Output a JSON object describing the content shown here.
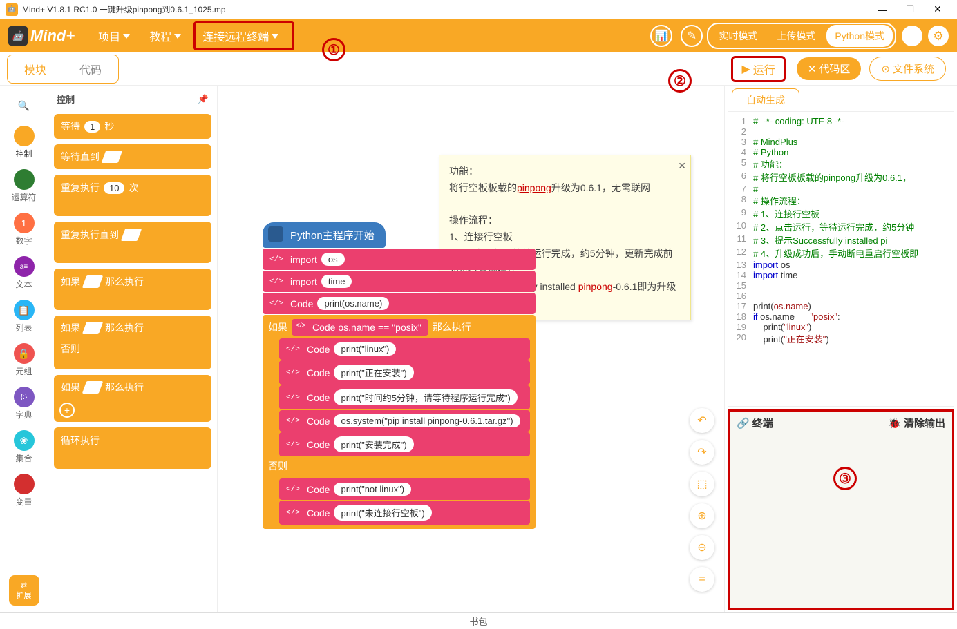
{
  "window": {
    "title": "Mind+ V1.8.1 RC1.0   一键升级pinpong到0.6.1_1025.mp"
  },
  "topmenu": {
    "logo": "Mind+",
    "project": "项目",
    "tutorial": "教程",
    "connect": "连接远程终端",
    "mode_realtime": "实时模式",
    "mode_upload": "上传模式",
    "mode_python": "Python模式"
  },
  "secbar": {
    "tab_blocks": "模块",
    "tab_code": "代码",
    "run": "运行",
    "code_area": "代码区",
    "file_system": "文件系统"
  },
  "annotations": {
    "a1": "①",
    "a2": "②",
    "a3": "③"
  },
  "categories": {
    "search": "",
    "control": "控制",
    "operators": "运算符",
    "numbers": "数字",
    "text": "文本",
    "list": "列表",
    "tuple": "元组",
    "dict": "字典",
    "set": "集合",
    "variables": "变量",
    "extension": "扩展"
  },
  "palette": {
    "header": "控制",
    "wait_label": "等待",
    "wait_val": "1",
    "wait_sec": "秒",
    "wait_until": "等待直到",
    "repeat": "重复执行",
    "repeat_val": "10",
    "repeat_times": "次",
    "repeat_until": "重复执行直到",
    "if_then": "如果",
    "then_exec": "那么执行",
    "else_lbl": "否则",
    "loop_forever": "循环执行"
  },
  "note": {
    "l1": "功能：",
    "l2a": "将行空板板载的",
    "l2link": "pinpong",
    "l2b": "升级为0.6.1，无需联网",
    "l3": "操作流程：",
    "l4": "1、连接行空板",
    "l5": "2、点击运行，等待运行完成，约5分钟，更新完成前勿进行其他操作",
    "l6a": "3、提示Successfully installed ",
    "l6link": "pinpong",
    "l6b": "-0.6.1即为升级成功"
  },
  "script": {
    "hat": "Python主程序开始",
    "imp": "import",
    "imp_os": "os",
    "imp_time": "time",
    "code_lbl": "Code",
    "c1": "print(os.name)",
    "if_lbl": "如果",
    "cond": "os.name == \"posix\"",
    "then_lbl": "那么执行",
    "c2": "print(\"linux\")",
    "c3": "print(\"正在安装\")",
    "c4": "print(\"时间约5分钟，请等待程序运行完成\")",
    "c5": "os.system(\"pip install pinpong-0.6.1.tar.gz\")",
    "c6": "print(\"安装完成\")",
    "else_lbl": "否则",
    "c7": "print(\"not linux\")",
    "c8": "print(\"未连接行空板\")"
  },
  "code_tab": "自动生成",
  "code_lines": [
    {
      "n": "1",
      "cls": "cm",
      "t": "#  -*- coding: UTF-8 -*-"
    },
    {
      "n": "2",
      "cls": "",
      "t": ""
    },
    {
      "n": "3",
      "cls": "cm",
      "t": "# MindPlus"
    },
    {
      "n": "4",
      "cls": "cm",
      "t": "# Python"
    },
    {
      "n": "5",
      "cls": "cm",
      "t": "# 功能："
    },
    {
      "n": "6",
      "cls": "cm",
      "t": "# 将行空板板载的pinpong升级为0.6.1，"
    },
    {
      "n": "7",
      "cls": "cm",
      "t": "#"
    },
    {
      "n": "8",
      "cls": "cm",
      "t": "# 操作流程："
    },
    {
      "n": "9",
      "cls": "cm",
      "t": "# 1、连接行空板"
    },
    {
      "n": "10",
      "cls": "cm",
      "t": "# 2、点击运行，等待运行完成，约5分钟"
    },
    {
      "n": "11",
      "cls": "cm",
      "t": "# 3、提示Successfully installed pi"
    },
    {
      "n": "12",
      "cls": "cm",
      "t": "# 4、升级成功后，手动断电重启行空板即"
    },
    {
      "n": "13",
      "cls": "",
      "t": "import os"
    },
    {
      "n": "14",
      "cls": "",
      "t": "import time"
    },
    {
      "n": "15",
      "cls": "",
      "t": ""
    },
    {
      "n": "16",
      "cls": "",
      "t": ""
    },
    {
      "n": "17",
      "cls": "",
      "t": "print(os.name)"
    },
    {
      "n": "18",
      "cls": "",
      "t": "if os.name == \"posix\":"
    },
    {
      "n": "19",
      "cls": "",
      "t": "    print(\"linux\")"
    },
    {
      "n": "20",
      "cls": "",
      "t": "    print(\"正在安装\")"
    }
  ],
  "terminal": {
    "title": "终端",
    "clear": "清除输出",
    "cursor": "–"
  },
  "bottom": "书包"
}
